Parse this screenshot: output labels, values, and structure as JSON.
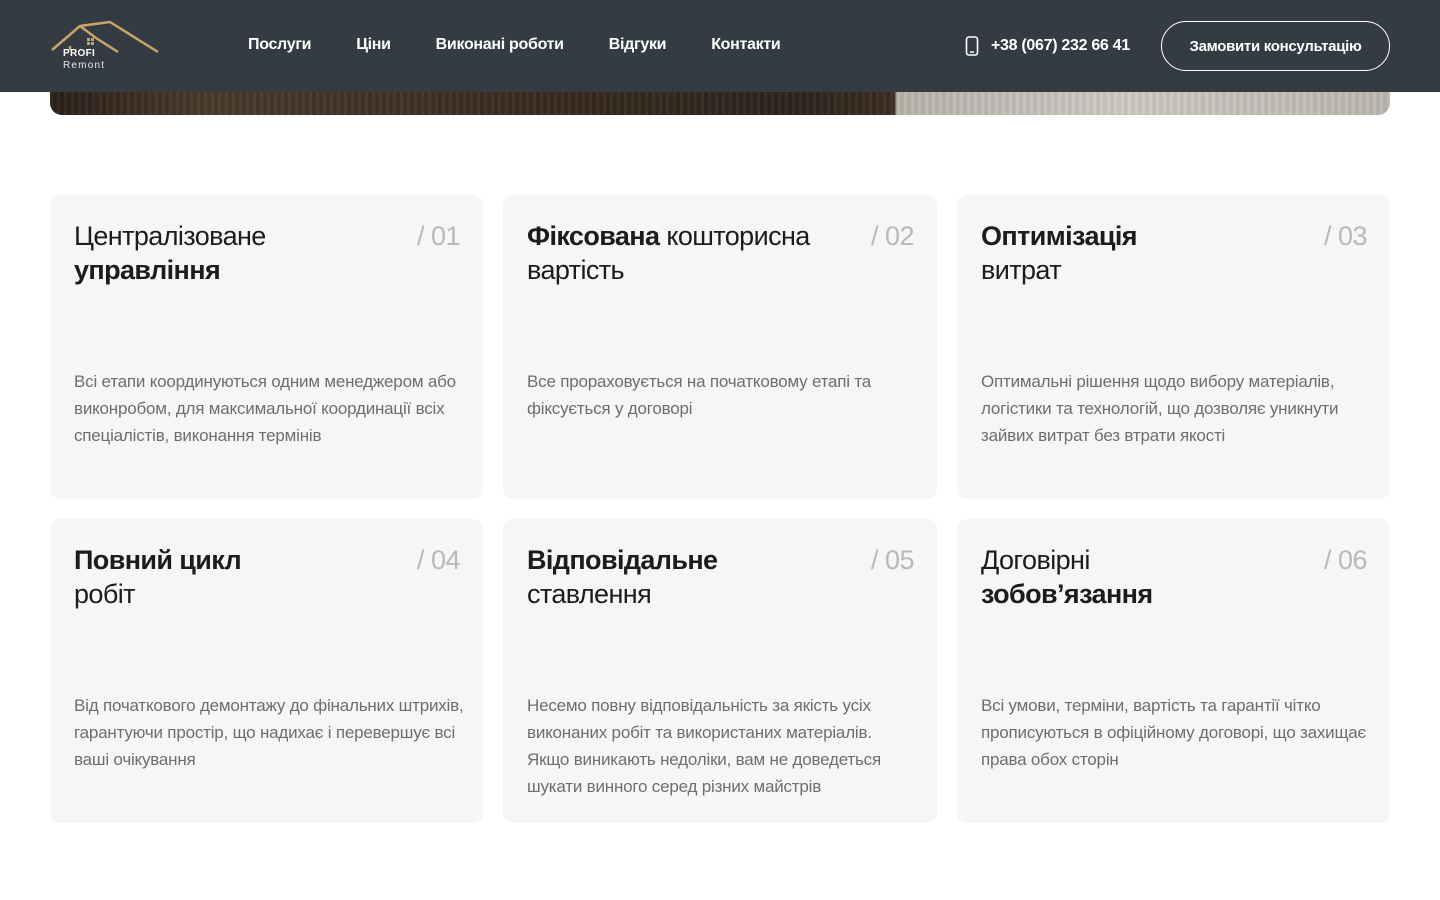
{
  "brand": {
    "logo_line1": "PROFI",
    "logo_line2": "Remont"
  },
  "nav": {
    "items": [
      {
        "label": "Послуги"
      },
      {
        "label": "Ціни"
      },
      {
        "label": "Виконані роботи"
      },
      {
        "label": "Відгуки"
      },
      {
        "label": "Контакти"
      }
    ]
  },
  "contact": {
    "phone": "+38 (067) 232 66 41",
    "cta_label": "Замовити консультацію"
  },
  "colors": {
    "header_bg": "#353b42",
    "card_bg": "#f6f6f6",
    "accent_roof": "#c9a46a"
  },
  "cards": [
    {
      "num": "/ 01",
      "title_regular_1": "Централізоване",
      "title_bold": "управління",
      "title_regular_2": "",
      "text": "Всі етапи координуються одним менеджером або виконробом, для максимальної координації всіх спеціалістів, виконання термінів"
    },
    {
      "num": "/ 02",
      "title_bold": "Фіксована",
      "title_regular_1": "кошторисна вартість",
      "text": "Все прораховується на початковому етапі та фіксується у договорі"
    },
    {
      "num": "/ 03",
      "title_bold": "Оптимізація",
      "title_regular_1": "витрат",
      "text": "Оптимальні рішення щодо вибору матеріалів, логістики та технологій, що дозволяє уникнути зайвих витрат без втрати якості"
    },
    {
      "num": "/ 04",
      "title_bold": "Повний цикл",
      "title_regular_1": "робіт",
      "text": "Від початкового демонтажу до фінальних штрихів, гарантуючи простір, що надихає і перевершує всі ваші очікування"
    },
    {
      "num": "/ 05",
      "title_bold": "Відповідальне",
      "title_regular_1": "ставлення",
      "text": "Несемо повну відповідальність за якість усіх виконаних робіт та використаних матеріалів. Якщо виникають недоліки, вам не доведеться шукати винного серед різних майстрів"
    },
    {
      "num": "/ 06",
      "title_regular_1": "Договірні",
      "title_bold": "зобов’язання",
      "text": "Всі умови, терміни, вартість та гарантії чітко прописуються в офіційному договорі, що захищає права обох сторін"
    }
  ]
}
